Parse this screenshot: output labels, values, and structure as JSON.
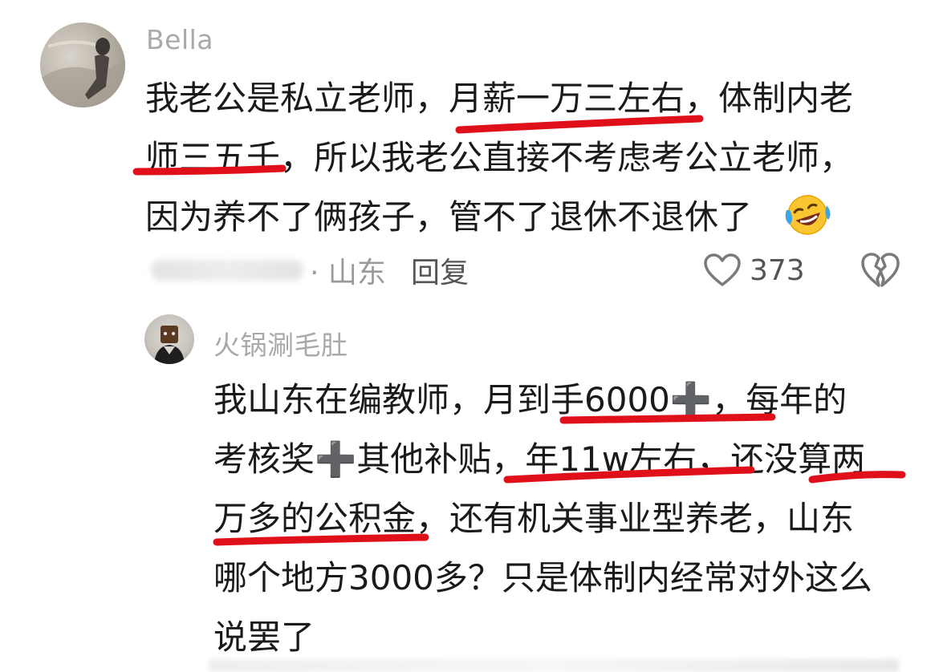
{
  "comment": {
    "username": "Bella",
    "lines": [
      "我老公是私立老师，月薪一万三左右，体制内老",
      "师三五千，所以我老公直接不考虑考公立老师，",
      "因为养不了俩孩子，管不了退休不退休了"
    ],
    "emoji": "laughing-crying-emoji",
    "location": "· 山东",
    "reply_label": "回复",
    "like_count": "373"
  },
  "reply": {
    "username": "火锅涮毛肚",
    "lines": [
      "我山东在编教师，月到手6000➕，每年的",
      "考核奖➕其他补贴，年11w左右，还没算两",
      "万多的公积金，还有机关事业型养老，山东",
      "哪个地方3000多？只是体制内经常对外这么",
      "说罢了"
    ]
  },
  "highlight_color": "#e0101a",
  "icons": [
    "heart-icon",
    "broken-heart-icon"
  ]
}
